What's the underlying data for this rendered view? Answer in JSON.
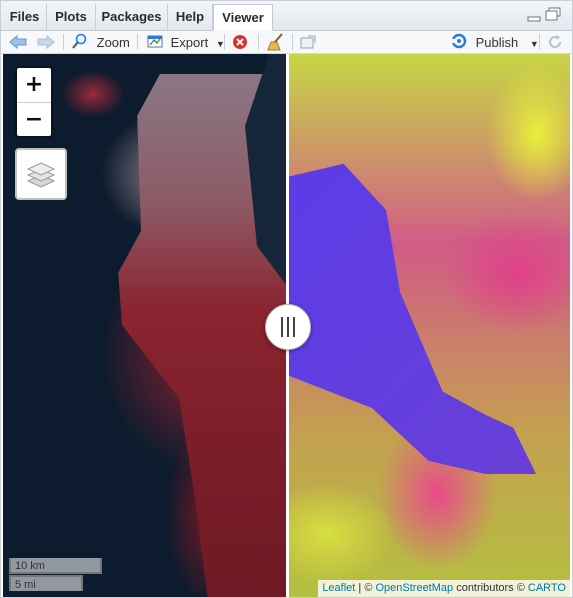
{
  "tabs": [
    {
      "label": "Files",
      "active": false
    },
    {
      "label": "Plots",
      "active": false
    },
    {
      "label": "Packages",
      "active": false
    },
    {
      "label": "Help",
      "active": false
    },
    {
      "label": "Viewer",
      "active": true
    }
  ],
  "toolbar": {
    "zoom_label": "Zoom",
    "export_label": "Export",
    "publish_label": "Publish"
  },
  "map": {
    "zoom_in": "+",
    "zoom_out": "−",
    "scale_metric": "10 km",
    "scale_imperial": "5 mi",
    "attribution": {
      "leaflet": "Leaflet",
      "sep1": " | © ",
      "osm": "OpenStreetMap",
      "contrib": " contributors © ",
      "carto": "CARTO"
    }
  },
  "colors": {
    "accent_blue": "#2a7bd6",
    "stop_red": "#d9322b",
    "link": "#0078a8"
  },
  "icons": [
    "back-arrow-icon",
    "forward-arrow-icon",
    "zoom-icon",
    "export-icon",
    "clear-icon",
    "broom-icon",
    "popout-icon",
    "publish-icon",
    "refresh-icon",
    "minimize-icon",
    "maximize-icon",
    "layers-icon"
  ]
}
